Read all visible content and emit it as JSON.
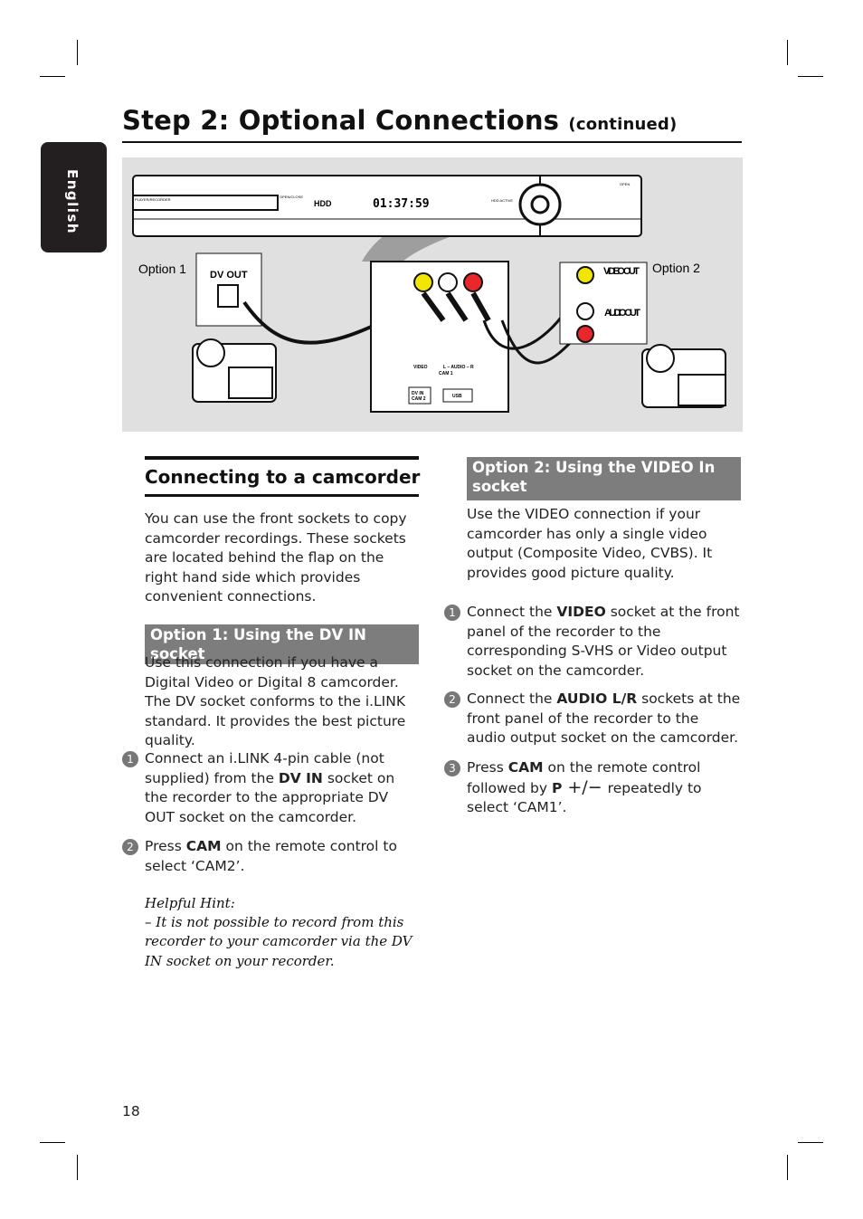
{
  "header": {
    "title": "Step 2: Optional Connections",
    "title_suffix": "(continued)"
  },
  "side_tab": {
    "label": "English"
  },
  "illustration": {
    "front_panel": {
      "display": "01:37:59",
      "brand_left": "PLAYER/RECORDER",
      "open_close": "OPEN/CLOSE",
      "hdd": "HDD",
      "hdd_active": "HDD ACTIVE",
      "open": "OPEN"
    },
    "option1_label": "Option 1",
    "dv_out": "DV OUT",
    "option2_label": "Option 2",
    "video_out": "VIDEO OUT",
    "audio_out": "AUDIO OUT",
    "sockets": {
      "video": "VIDEO",
      "audio": "L – AUDIO – R",
      "cam1": "CAM 1",
      "dv_in": "DV IN",
      "cam2": "CAM 2",
      "usb": "USB"
    }
  },
  "left": {
    "heading": "Connecting to a camcorder",
    "intro": "You can use the front sockets to copy camcorder recordings. These sockets are located behind the flap on the right hand side which provides convenient connections.",
    "option1": {
      "title": "Option 1: Using the DV IN socket",
      "desc": "Use this connection if you have a Digital Video or Digital 8 camcorder. The DV socket conforms to the i.LINK standard. It provides the best picture quality.",
      "steps": [
        {
          "n": "1",
          "a": "Connect an i.LINK 4-pin cable (not supplied) from the ",
          "b": "DV IN",
          "c": " socket on the recorder to the appropriate DV OUT socket on the camcorder."
        },
        {
          "n": "2",
          "a": "Press ",
          "b": "CAM",
          "c": " on the remote control to select ‘CAM2’."
        }
      ]
    },
    "hint": {
      "title": "Helpful Hint:",
      "text": "–  It is not possible to record from this recorder to your camcorder via the DV IN socket on your recorder."
    }
  },
  "right": {
    "option2": {
      "title": "Option 2: Using the VIDEO In socket",
      "desc": "Use the VIDEO connection if your camcorder has only a single video output (Composite Video, CVBS). It provides good picture quality.",
      "steps": [
        {
          "n": "1",
          "a": "Connect the ",
          "b": "VIDEO",
          "c": " socket at the front panel of the recorder to the corresponding S-VHS or Video output socket on the camcorder."
        },
        {
          "n": "2",
          "a": "Connect the ",
          "b": "AUDIO L/R",
          "c": " sockets at the front panel of the recorder to the audio output socket on the camcorder."
        },
        {
          "n": "3",
          "a": "Press ",
          "b": "CAM",
          "c": " on the remote control followed by ",
          "d": "P",
          "e": " +/− ",
          "f": "repeatedly to select ‘CAM1’."
        }
      ]
    }
  },
  "footer": {
    "page_number": "18"
  }
}
